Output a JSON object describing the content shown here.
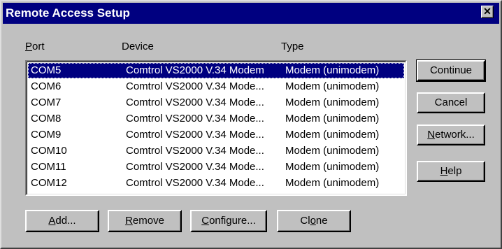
{
  "window": {
    "title": "Remote Access Setup",
    "close_glyph": "✕"
  },
  "columns": {
    "port": {
      "mnemonic": "P",
      "rest": "ort"
    },
    "device": "Device",
    "type": "Type"
  },
  "rows": [
    {
      "port": "COM5",
      "device": "Comtrol VS2000 V.34 Modem",
      "type": "Modem (unimodem)",
      "selected": true
    },
    {
      "port": "COM6",
      "device": "Comtrol VS2000 V.34 Mode...",
      "type": "Modem (unimodem)",
      "selected": false
    },
    {
      "port": "COM7",
      "device": "Comtrol VS2000 V.34 Mode...",
      "type": "Modem (unimodem)",
      "selected": false
    },
    {
      "port": "COM8",
      "device": "Comtrol VS2000 V.34 Mode...",
      "type": "Modem (unimodem)",
      "selected": false
    },
    {
      "port": "COM9",
      "device": "Comtrol VS2000 V.34 Mode...",
      "type": "Modem (unimodem)",
      "selected": false
    },
    {
      "port": "COM10",
      "device": "Comtrol VS2000 V.34 Mode...",
      "type": "Modem (unimodem)",
      "selected": false
    },
    {
      "port": "COM11",
      "device": "Comtrol VS2000 V.34 Mode...",
      "type": "Modem (unimodem)",
      "selected": false
    },
    {
      "port": "COM12",
      "device": "Comtrol VS2000 V.34 Mode...",
      "type": "Modem (unimodem)",
      "selected": false
    }
  ],
  "right_buttons": {
    "continue": {
      "pre": "Continue",
      "mnemonic": "",
      "post": ""
    },
    "cancel": {
      "pre": "Cancel",
      "mnemonic": "",
      "post": ""
    },
    "network": {
      "pre": "",
      "mnemonic": "N",
      "post": "etwork..."
    },
    "help": {
      "pre": "",
      "mnemonic": "H",
      "post": "elp"
    }
  },
  "bottom_buttons": {
    "add": {
      "pre": "",
      "mnemonic": "A",
      "post": "dd..."
    },
    "remove": {
      "pre": "",
      "mnemonic": "R",
      "post": "emove"
    },
    "configure": {
      "pre": "",
      "mnemonic": "C",
      "post": "onfigure..."
    },
    "clone": {
      "pre": "Cl",
      "mnemonic": "o",
      "post": "ne"
    }
  },
  "colors": {
    "title_bar": "#000080",
    "face": "#c0c0c0",
    "selection": "#000080"
  }
}
